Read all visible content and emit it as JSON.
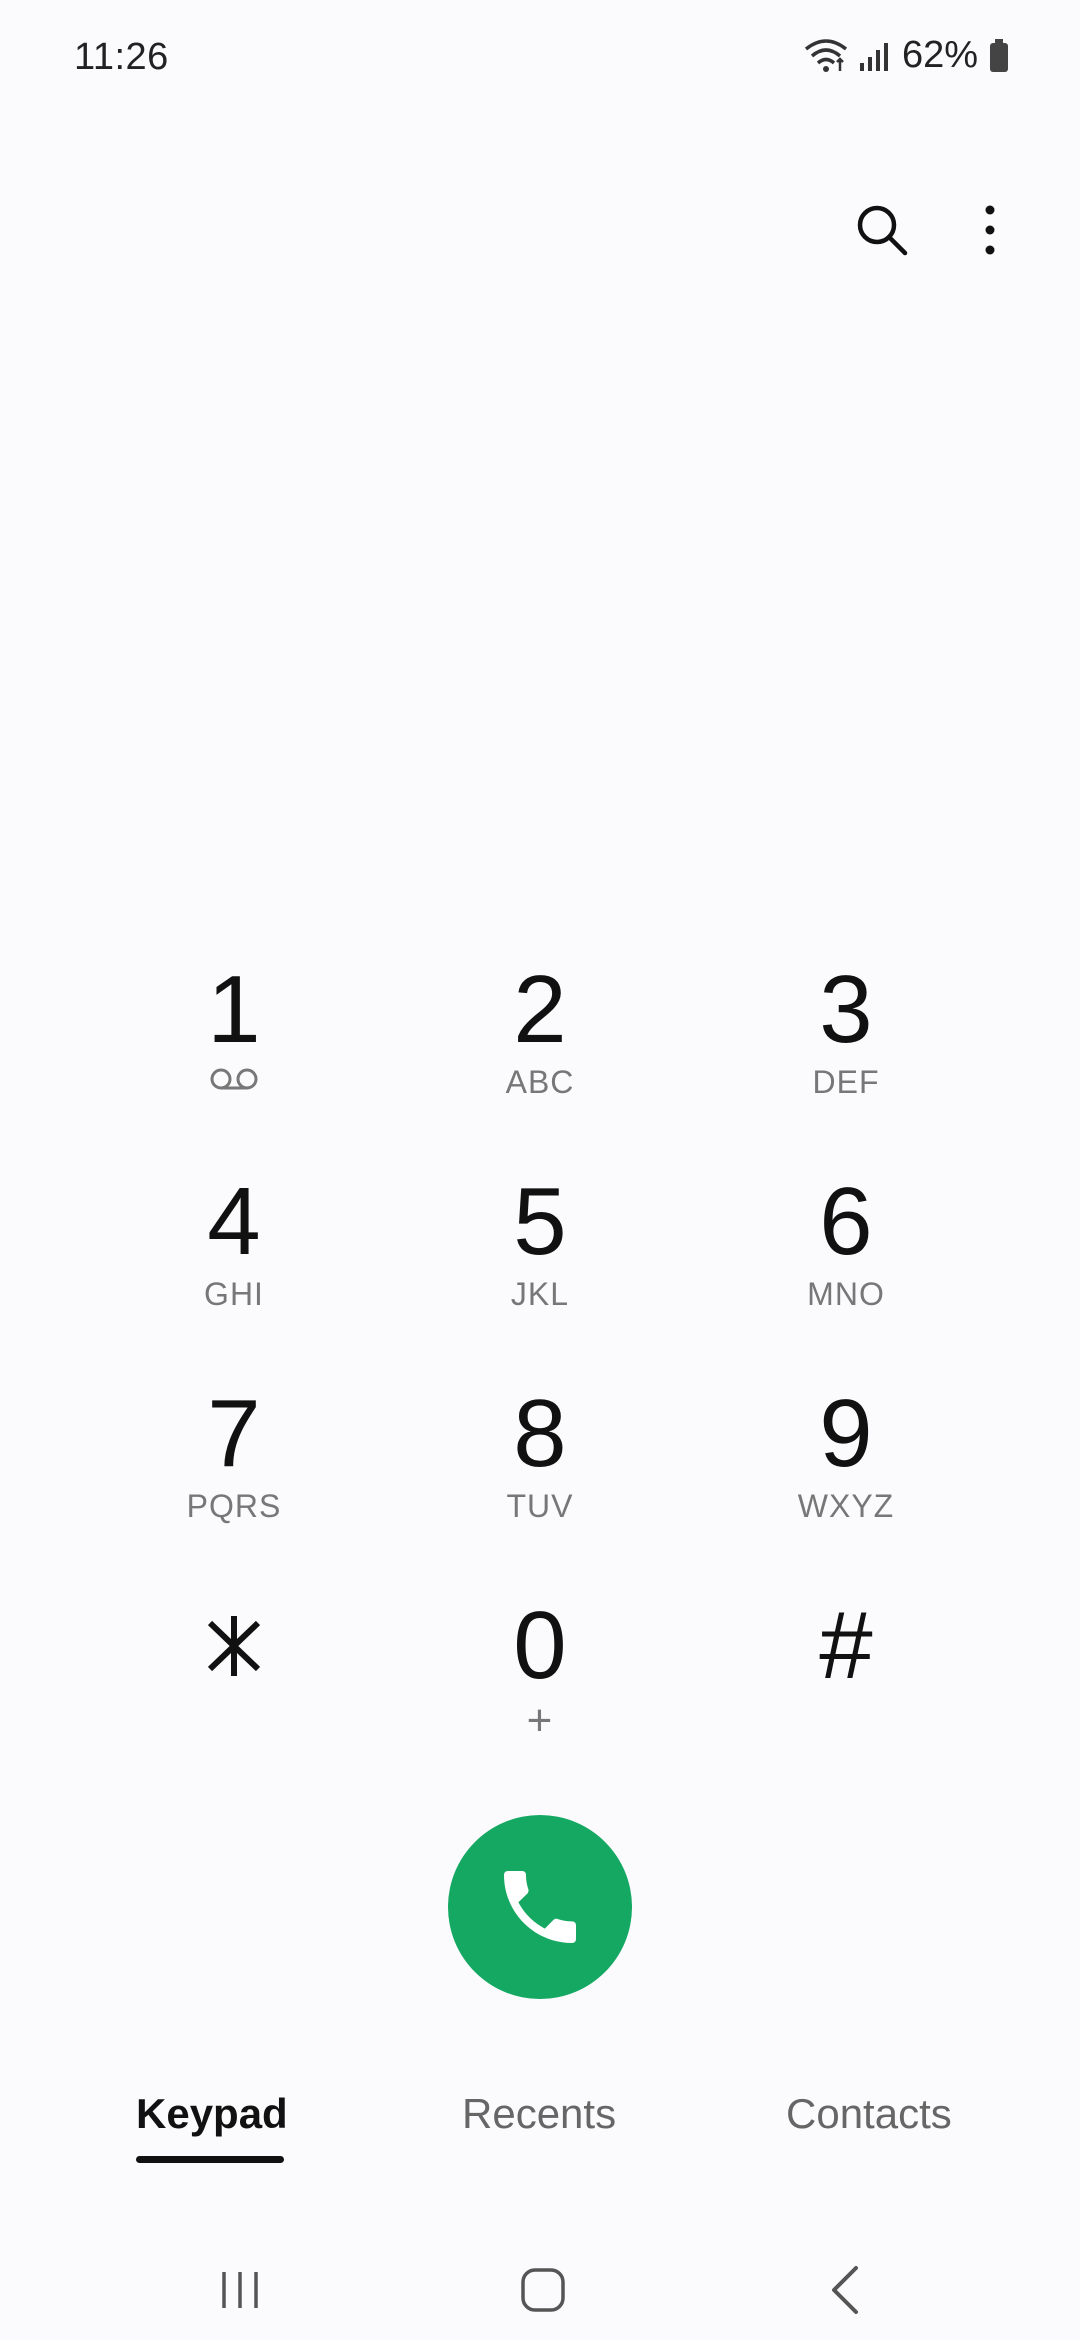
{
  "status_bar": {
    "time": "11:26",
    "battery": "62%"
  },
  "top_actions": {
    "search_icon": "search-icon",
    "more_icon": "more-vert-icon"
  },
  "keypad": {
    "rows": [
      [
        {
          "digit": "1",
          "sub": "voicemail-icon"
        },
        {
          "digit": "2",
          "sub": "ABC"
        },
        {
          "digit": "3",
          "sub": "DEF"
        }
      ],
      [
        {
          "digit": "4",
          "sub": "GHI"
        },
        {
          "digit": "5",
          "sub": "JKL"
        },
        {
          "digit": "6",
          "sub": "MNO"
        }
      ],
      [
        {
          "digit": "7",
          "sub": "PQRS"
        },
        {
          "digit": "8",
          "sub": "TUV"
        },
        {
          "digit": "9",
          "sub": "WXYZ"
        }
      ],
      [
        {
          "digit": "*",
          "sub": ""
        },
        {
          "digit": "0",
          "sub": "+"
        },
        {
          "digit": "#",
          "sub": ""
        }
      ]
    ]
  },
  "call_button": {
    "icon": "phone-icon",
    "color": "#14a862"
  },
  "tabs": [
    {
      "label": "Keypad",
      "active": true
    },
    {
      "label": "Recents",
      "active": false
    },
    {
      "label": "Contacts",
      "active": false
    }
  ],
  "nav_bar": {
    "recents_icon": "recent-apps-icon",
    "home_icon": "home-icon",
    "back_icon": "back-icon"
  }
}
